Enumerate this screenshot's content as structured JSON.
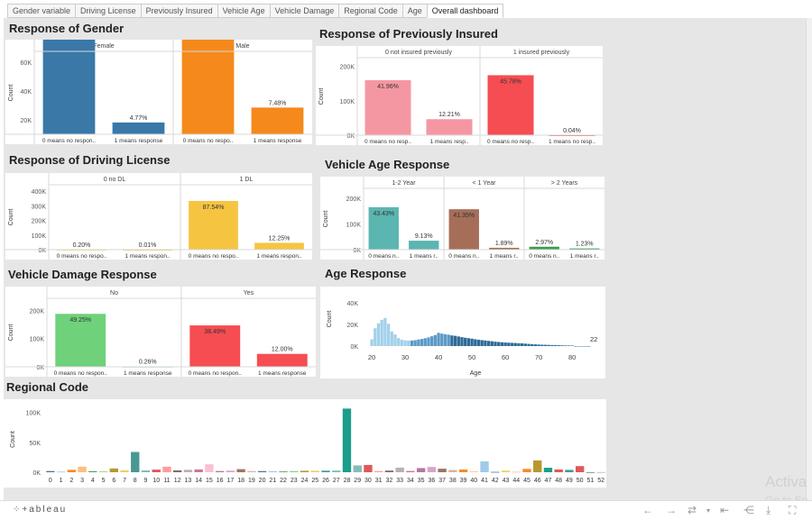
{
  "tabs": [
    "Gender variable",
    "Driving License",
    "Previously Insured",
    "Vehicle Age",
    "Vehicle Damage",
    "Regional Code",
    "Age",
    "Overall dashboard"
  ],
  "active_tab": 7,
  "footer": {
    "logo": "⁘+ableau"
  },
  "watermark": {
    "line1": "Activa",
    "line2": "Go to Se"
  },
  "chart_data": [
    {
      "id": "gender",
      "type": "bar",
      "title": "Response of Gender",
      "ylabel": "Count",
      "panels": [
        {
          "header": "Female",
          "categories": [
            "0 means no respon..",
            "1 means response"
          ],
          "values": [
            156835,
            18186
          ],
          "labels": [
            "41.15%",
            "4.77%"
          ],
          "colors": [
            "#3a78a8",
            "#3a78a8"
          ]
        },
        {
          "header": "Male",
          "categories": [
            "0 means no respo..",
            "1 means response"
          ],
          "values": [
            177564,
            28524
          ],
          "labels": [
            "46.59%",
            "7.48%"
          ],
          "colors": [
            "#f5891b",
            "#f5891b"
          ]
        }
      ],
      "ylim": [
        10000,
        65000
      ],
      "yticks": [
        {
          "v": 20000,
          "t": "20K"
        },
        {
          "v": 40000,
          "t": "40K"
        },
        {
          "v": 60000,
          "t": "60K"
        }
      ]
    },
    {
      "id": "insured",
      "type": "bar",
      "title": "Response of Previously Insured",
      "ylabel": "Count",
      "panels": [
        {
          "header": "0 not insured previously",
          "categories": [
            "0 means no resp..",
            "1 means resp.."
          ],
          "values": [
            159929,
            46552
          ],
          "labels": [
            "41.96%",
            "12.21%"
          ],
          "colors": [
            "#f597a3",
            "#f597a3"
          ]
        },
        {
          "header": "1 insured previously",
          "categories": [
            "0 means no resp..",
            "1 means no resp.."
          ],
          "values": [
            174470,
            158
          ],
          "labels": [
            "45.78%",
            "0.04%"
          ],
          "colors": [
            "#f54d52",
            "#f54d52"
          ]
        }
      ],
      "ylim": [
        0,
        215000
      ],
      "yticks": [
        {
          "v": 0,
          "t": "0K"
        },
        {
          "v": 100000,
          "t": "100K"
        },
        {
          "v": 200000,
          "t": "200K"
        }
      ]
    },
    {
      "id": "license",
      "type": "bar",
      "title": "Response of Driving License",
      "ylabel": "Count",
      "panels": [
        {
          "header": "0 no DL",
          "categories": [
            "0 means no respo..",
            "1 means respon.."
          ],
          "values": [
            771,
            41
          ],
          "labels": [
            "0.20%",
            "0.01%"
          ],
          "colors": [
            "#f5c542",
            "#f5c542"
          ]
        },
        {
          "header": "1 DL",
          "categories": [
            "0 means no respo..",
            "1 means respon.."
          ],
          "values": [
            333628,
            46669
          ],
          "labels": [
            "87.54%",
            "12.25%"
          ],
          "colors": [
            "#f5c542",
            "#f5c542"
          ]
        }
      ],
      "ylim": [
        0,
        420000
      ],
      "yticks": [
        {
          "v": 0,
          "t": "0K"
        },
        {
          "v": 100000,
          "t": "100K"
        },
        {
          "v": 200000,
          "t": "200K"
        },
        {
          "v": 300000,
          "t": "300K"
        },
        {
          "v": 400000,
          "t": "400K"
        }
      ]
    },
    {
      "id": "vehage",
      "type": "bar",
      "title": "Vehicle Age Response",
      "ylabel": "Count",
      "panels": [
        {
          "header": "1-2 Year",
          "categories": [
            "0 means n..",
            "1 means r.."
          ],
          "values": [
            165510,
            34806
          ],
          "labels": [
            "43.43%",
            "9.13%"
          ],
          "colors": [
            "#5bb5b0",
            "#5bb5b0"
          ]
        },
        {
          "header": "< 1 Year",
          "categories": [
            "0 means n..",
            "1 means r.."
          ],
          "values": [
            157584,
            7202
          ],
          "labels": [
            "41.35%",
            "1.89%"
          ],
          "colors": [
            "#a66e58",
            "#a66e58"
          ]
        },
        {
          "header": "> 2 Years",
          "categories": [
            "0 means n..",
            "1 means r.."
          ],
          "values": [
            11305,
            4702
          ],
          "labels": [
            "2.97%",
            "1.23%"
          ],
          "colors": [
            "#3a9e4b",
            "#3a9e4b"
          ]
        }
      ],
      "ylim": [
        0,
        225000
      ],
      "yticks": [
        {
          "v": 0,
          "t": "0K"
        },
        {
          "v": 100000,
          "t": "100K"
        },
        {
          "v": 200000,
          "t": "200K"
        }
      ]
    },
    {
      "id": "damage",
      "type": "bar",
      "title": "Vehicle Damage Response",
      "ylabel": "Count",
      "panels": [
        {
          "header": "No",
          "categories": [
            "0 means no respon..",
            "1 means response"
          ],
          "values": [
            187714,
            982
          ],
          "labels": [
            "49.25%",
            "0.26%"
          ],
          "colors": [
            "#6fd17a",
            "#6fd17a"
          ]
        },
        {
          "header": "Yes",
          "categories": [
            "0 means no respon..",
            "1 means response"
          ],
          "values": [
            146685,
            45728
          ],
          "labels": [
            "38.49%",
            "12.00%"
          ],
          "colors": [
            "#f54d52",
            "#f54d52"
          ]
        }
      ],
      "ylim": [
        0,
        230000
      ],
      "yticks": [
        {
          "v": 0,
          "t": "0K"
        },
        {
          "v": 100000,
          "t": "100K"
        },
        {
          "v": 200000,
          "t": "200K"
        }
      ]
    },
    {
      "id": "age",
      "type": "bar",
      "title": "Age Response",
      "xlabel": "Age",
      "ylabel": "Count",
      "x": [
        20,
        21,
        22,
        23,
        24,
        25,
        26,
        27,
        28,
        29,
        30,
        31,
        32,
        33,
        34,
        35,
        36,
        37,
        38,
        39,
        40,
        41,
        42,
        43,
        44,
        45,
        46,
        47,
        48,
        49,
        50,
        51,
        52,
        53,
        54,
        55,
        56,
        57,
        58,
        59,
        60,
        61,
        62,
        63,
        64,
        65,
        66,
        67,
        68,
        69,
        70,
        71,
        72,
        73,
        74,
        75,
        76,
        77,
        78,
        79,
        80,
        81,
        82,
        83,
        84,
        85
      ],
      "values": [
        6232,
        16457,
        20964,
        24256,
        25960,
        20636,
        13535,
        10688,
        7421,
        5823,
        5327,
        5125,
        5092,
        5428,
        6089,
        6537,
        7231,
        8007,
        9068,
        10201,
        12198,
        11537,
        10845,
        10541,
        9810,
        9470,
        8847,
        8253,
        7693,
        7312,
        6839,
        6314,
        5813,
        5513,
        5106,
        4782,
        4462,
        4038,
        3784,
        3525,
        3283,
        3126,
        2958,
        2826,
        2620,
        2485,
        2238,
        1992,
        1766,
        1573,
        1414,
        1268,
        1172,
        1066,
        941,
        826,
        733,
        668,
        564,
        501,
        480,
        5,
        6,
        3,
        2,
        3
      ],
      "end_label": "22",
      "xticks": [
        20,
        30,
        40,
        50,
        60,
        70,
        80
      ],
      "ylim": [
        0,
        50000
      ],
      "yticks": [
        {
          "v": 0,
          "t": "0K"
        },
        {
          "v": 20000,
          "t": "20K"
        },
        {
          "v": 40000,
          "t": "40K"
        }
      ]
    },
    {
      "id": "region",
      "type": "bar",
      "title": "Regional Code",
      "ylabel": "Count",
      "categories": [
        "0",
        "1",
        "2",
        "3",
        "4",
        "5",
        "6",
        "7",
        "8",
        "9",
        "10",
        "11",
        "12",
        "13",
        "14",
        "15",
        "16",
        "17",
        "18",
        "19",
        "20",
        "21",
        "22",
        "23",
        "24",
        "25",
        "26",
        "27",
        "28",
        "29",
        "30",
        "31",
        "32",
        "33",
        "34",
        "35",
        "36",
        "37",
        "38",
        "39",
        "40",
        "41",
        "42",
        "43",
        "44",
        "45",
        "46",
        "47",
        "48",
        "49",
        "50",
        "51",
        "52"
      ],
      "values": [
        2021,
        1008,
        4038,
        9251,
        1801,
        1279,
        6280,
        3279,
        33877,
        3101,
        4374,
        9232,
        3198,
        4036,
        4678,
        13308,
        2007,
        2617,
        5153,
        1935,
        1935,
        1847,
        1309,
        1960,
        2415,
        2503,
        2587,
        2823,
        106415,
        11371,
        12191,
        1960,
        2787,
        7654,
        2094,
        6942,
        8797,
        5934,
        3760,
        4647,
        1295,
        18263,
        591,
        2639,
        808,
        5605,
        19749,
        7436,
        4681,
        3930,
        10243,
        183,
        267
      ],
      "colors": [
        "#4e79a7",
        "#a0cbe8",
        "#f28e2b",
        "#ffbe7d",
        "#59a14f",
        "#8cd17d",
        "#b6992d",
        "#f1ce63",
        "#499894",
        "#86bcb6",
        "#e15759",
        "#ff9d9a",
        "#79706e",
        "#bab0ac",
        "#d37295",
        "#fabfd2",
        "#b07aa1",
        "#d4a6c8",
        "#9d7660",
        "#d7b5a6",
        "#4e79a7",
        "#a0cbe8",
        "#59a14f",
        "#8cd17d",
        "#b6992d",
        "#f1ce63",
        "#499894",
        "#86bcb6",
        "#1b9e8a",
        "#86bcb6",
        "#e15759",
        "#ff9d9a",
        "#79706e",
        "#bab0ac",
        "#d37295",
        "#b07aa1",
        "#d4a6c8",
        "#9d7660",
        "#d7b5a6",
        "#f28e2b",
        "#ffbe7d",
        "#a0cbe8",
        "#4e79a7",
        "#f1ce63",
        "#ffbe7d",
        "#f28e2b",
        "#b6992d",
        "#1b9e8a",
        "#e15759",
        "#499894",
        "#e15759",
        "#79706e",
        "#bab0ac"
      ],
      "ylim": [
        0,
        110000
      ],
      "yticks": [
        {
          "v": 0,
          "t": "0K"
        },
        {
          "v": 50000,
          "t": "50K"
        },
        {
          "v": 100000,
          "t": "100K"
        }
      ]
    }
  ]
}
